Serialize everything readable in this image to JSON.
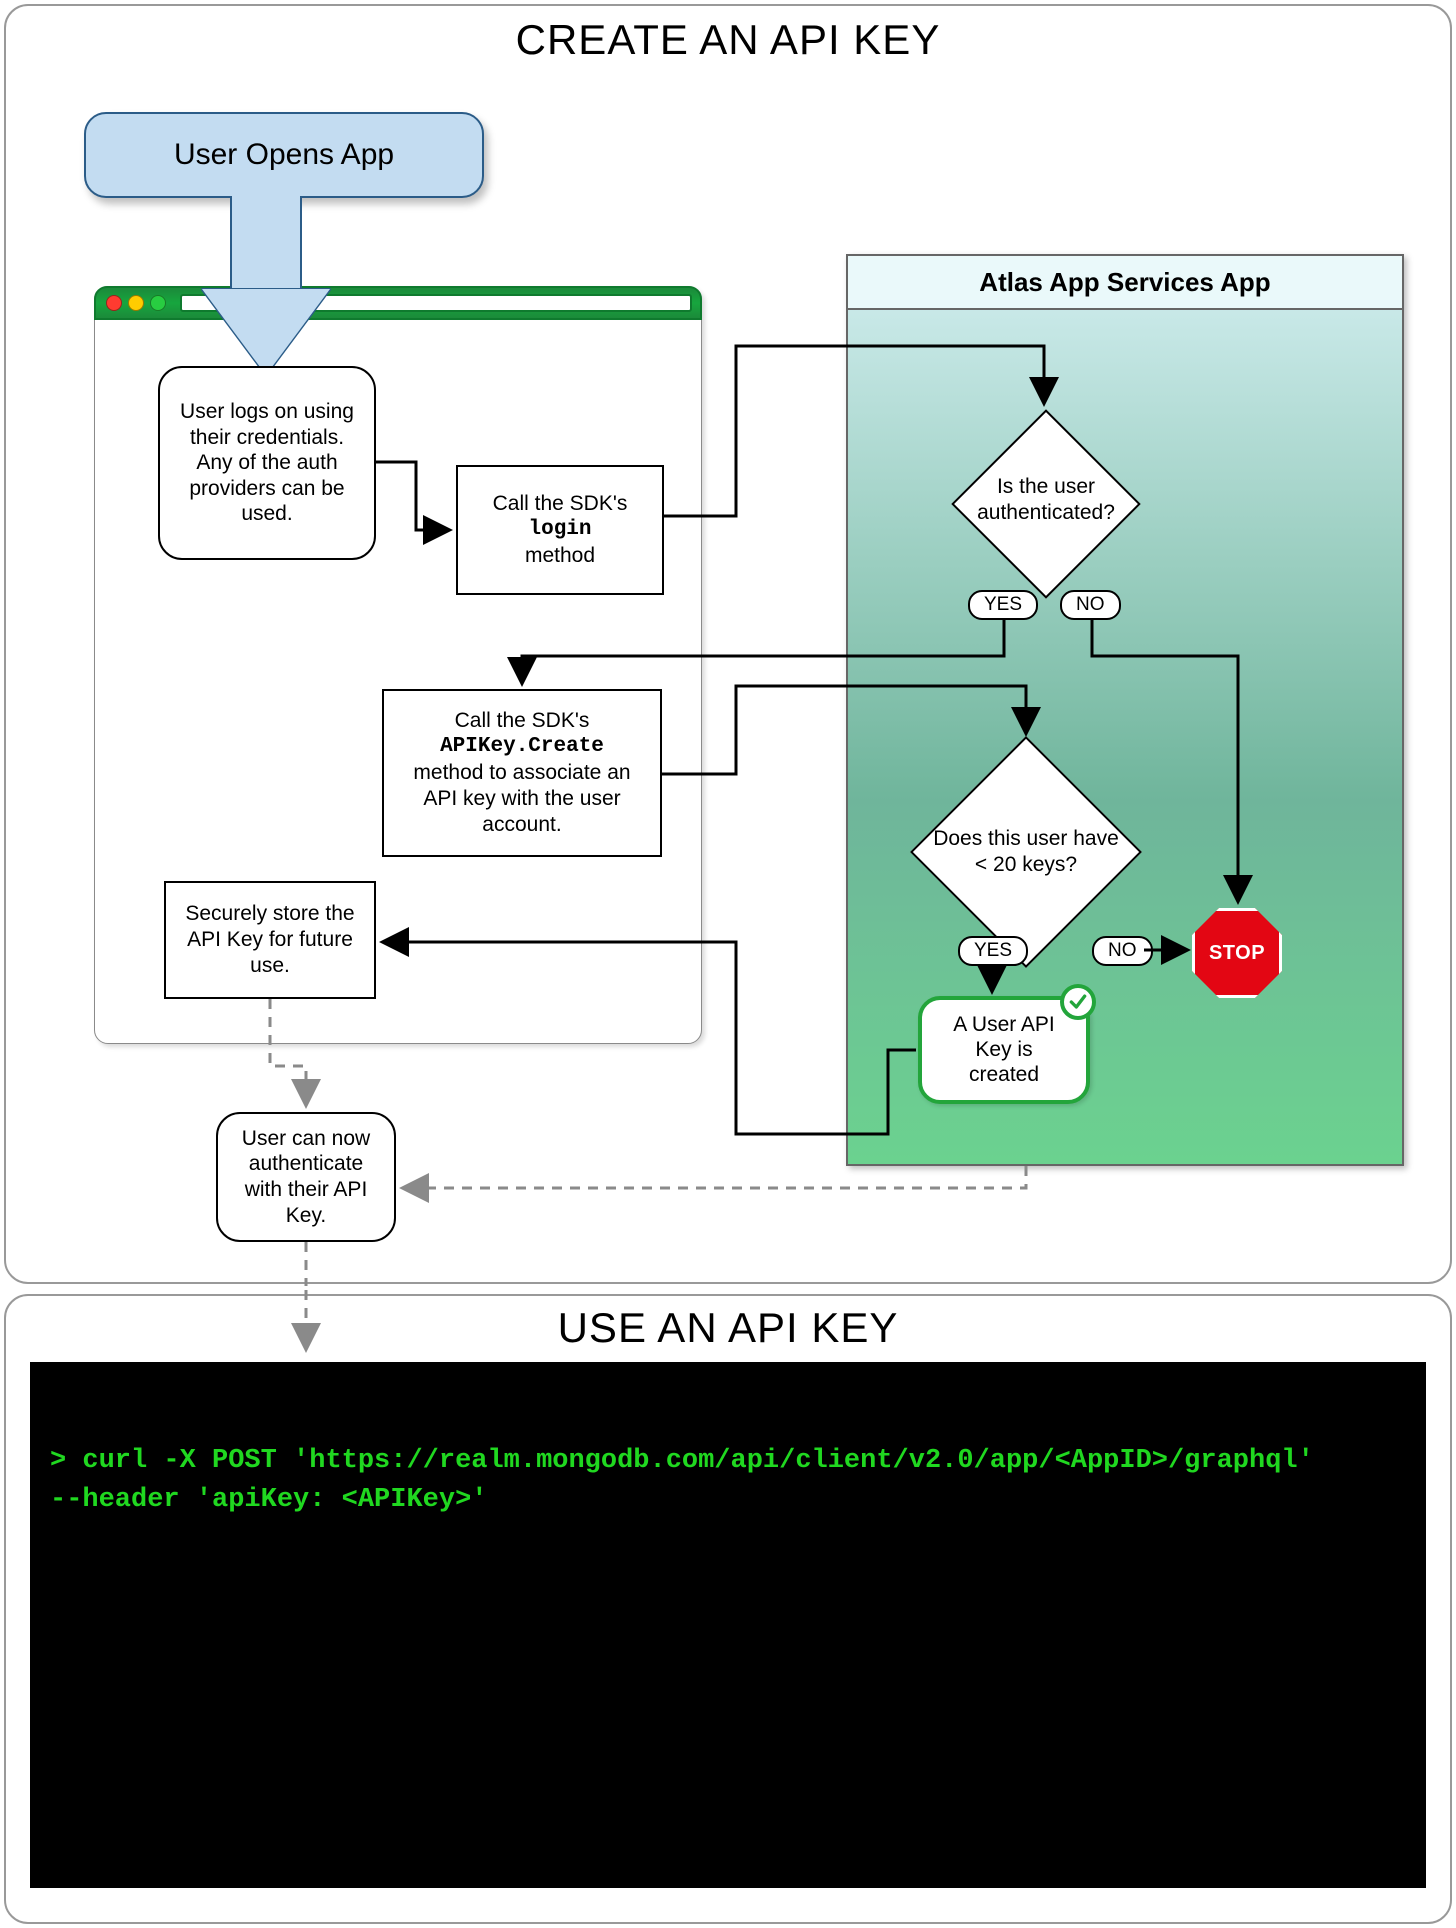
{
  "create": {
    "title": "CREATE AN API KEY",
    "start": "User Opens App",
    "browser": {
      "trafficLights": [
        "red",
        "yellow",
        "green"
      ]
    },
    "atlas": {
      "title": "Atlas App Services App"
    },
    "boxes": {
      "userLogs": "User logs on using their credentials. Any of the auth providers can be used.",
      "callLogin_pre": "Call the SDK's",
      "callLogin_mono": "login",
      "callLogin_post": "method",
      "callCreate_pre": "Call the SDK's",
      "callCreate_mono": "APIKey.Create",
      "callCreate_post": "method to associate an API key with the user account.",
      "store": "Securely store the API Key for future use.",
      "canAuth": "User can now authenticate with their API Key."
    },
    "decisions": {
      "isAuth": "Is the user authenticated?",
      "under20": "Does this user have < 20 keys?"
    },
    "labels": {
      "yes": "YES",
      "no": "NO",
      "stop": "STOP"
    },
    "created": "A User API Key is created"
  },
  "use": {
    "title": "USE AN API KEY",
    "terminal_line1": "> curl -X POST 'https://realm.mongodb.com/api/client/v2.0/app/<AppID>/graphql'",
    "terminal_line2": "--header 'apiKey: <APIKey>'"
  }
}
